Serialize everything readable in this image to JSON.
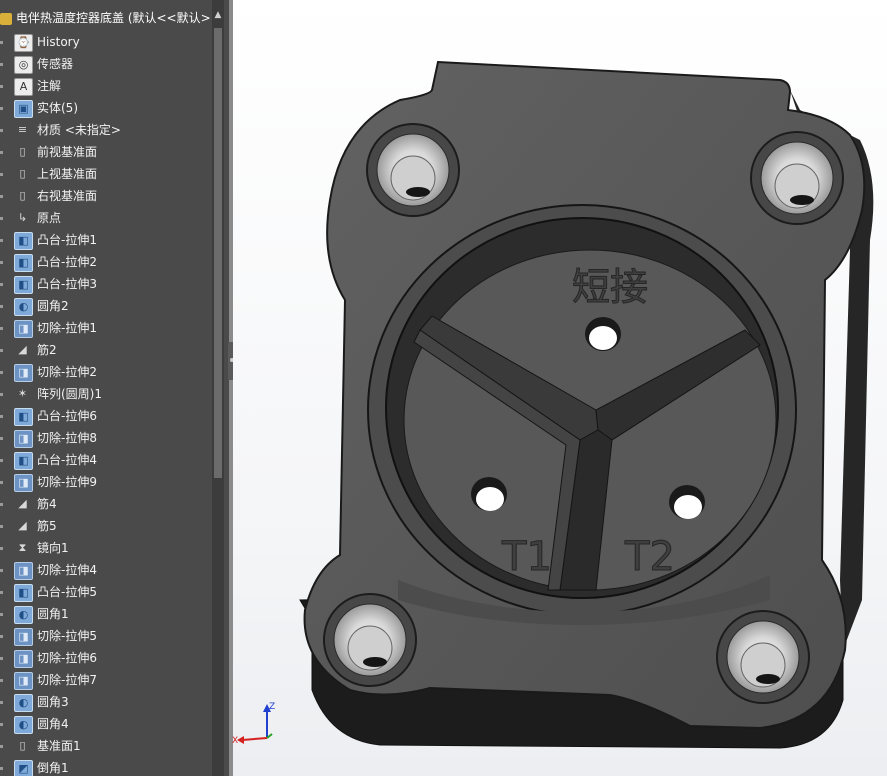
{
  "feature_tree": {
    "root_label": "电伴热温度控器底盖 (默认<<默认>",
    "items": [
      {
        "label": "History",
        "icon": "history-icon"
      },
      {
        "label": "传感器",
        "icon": "sensor-icon"
      },
      {
        "label": "注解",
        "icon": "annotation-icon"
      },
      {
        "label": "实体(5)",
        "icon": "solid-bodies-icon"
      },
      {
        "label": "材质 <未指定>",
        "icon": "material-icon"
      },
      {
        "label": "前视基准面",
        "icon": "plane-icon"
      },
      {
        "label": "上视基准面",
        "icon": "plane-icon"
      },
      {
        "label": "右视基准面",
        "icon": "plane-icon"
      },
      {
        "label": "原点",
        "icon": "origin-icon"
      },
      {
        "label": "凸台-拉伸1",
        "icon": "boss-extrude-icon"
      },
      {
        "label": "凸台-拉伸2",
        "icon": "boss-extrude-icon"
      },
      {
        "label": "凸台-拉伸3",
        "icon": "boss-extrude-icon"
      },
      {
        "label": "圆角2",
        "icon": "fillet-icon"
      },
      {
        "label": "切除-拉伸1",
        "icon": "cut-extrude-icon"
      },
      {
        "label": "筋2",
        "icon": "rib-icon"
      },
      {
        "label": "切除-拉伸2",
        "icon": "cut-extrude-icon"
      },
      {
        "label": "阵列(圆周)1",
        "icon": "circular-pattern-icon"
      },
      {
        "label": "凸台-拉伸6",
        "icon": "boss-extrude-icon"
      },
      {
        "label": "切除-拉伸8",
        "icon": "cut-extrude-icon"
      },
      {
        "label": "凸台-拉伸4",
        "icon": "boss-extrude-icon"
      },
      {
        "label": "切除-拉伸9",
        "icon": "cut-extrude-icon"
      },
      {
        "label": "筋4",
        "icon": "rib-icon"
      },
      {
        "label": "筋5",
        "icon": "rib-icon"
      },
      {
        "label": "镜向1",
        "icon": "mirror-icon"
      },
      {
        "label": "切除-拉伸4",
        "icon": "cut-extrude-icon"
      },
      {
        "label": "凸台-拉伸5",
        "icon": "boss-extrude-icon"
      },
      {
        "label": "圆角1",
        "icon": "fillet-icon"
      },
      {
        "label": "切除-拉伸5",
        "icon": "cut-extrude-icon"
      },
      {
        "label": "切除-拉伸6",
        "icon": "cut-extrude-icon"
      },
      {
        "label": "切除-拉伸7",
        "icon": "cut-extrude-icon"
      },
      {
        "label": "圆角3",
        "icon": "fillet-icon"
      },
      {
        "label": "圆角4",
        "icon": "fillet-icon"
      },
      {
        "label": "基准面1",
        "icon": "plane-icon"
      },
      {
        "label": "倒角1",
        "icon": "chamfer-icon"
      }
    ]
  },
  "model": {
    "engraving_top": "短接",
    "engraving_left": "T1",
    "engraving_right": "T2"
  },
  "triad": {
    "x_label": "X",
    "z_label": "Z"
  },
  "colors": {
    "tree_bg": "#4a4a4a",
    "model_face": "#5a5a5a",
    "model_dark": "#2e2e2e",
    "axis_x": "#d42020",
    "axis_y": "#22a022",
    "axis_z": "#2040d0"
  }
}
